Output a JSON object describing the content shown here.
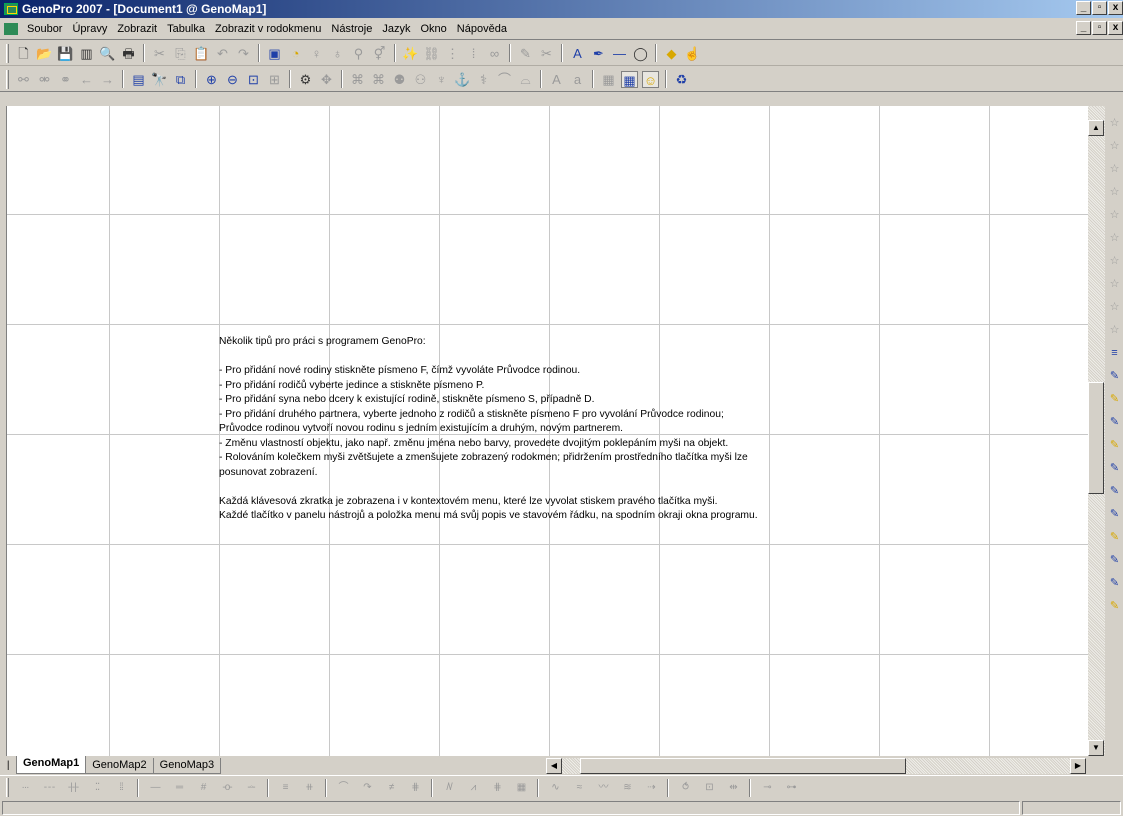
{
  "window": {
    "title": "GenoPro 2007 - [Document1 @ GenoMap1]",
    "controls": [
      "_",
      "▫",
      "x"
    ]
  },
  "menu": {
    "items": [
      "Soubor",
      "Úpravy",
      "Zobrazit",
      "Tabulka",
      "Zobrazit v rodokmenu",
      "Nástroje",
      "Jazyk",
      "Okno",
      "Nápověda"
    ]
  },
  "toolbar1": {
    "groups": [
      [
        {
          "icon": "new-document-icon",
          "glyph": "🗋",
          "color": "c-dark"
        },
        {
          "icon": "open-folder-icon",
          "glyph": "📂",
          "color": "c-yellow"
        },
        {
          "icon": "save-icon",
          "glyph": "💾",
          "color": "c-blue"
        },
        {
          "icon": "properties-icon",
          "glyph": "▥",
          "color": "c-dark"
        },
        {
          "icon": "print-preview-icon",
          "glyph": "🔍",
          "color": "c-dark"
        },
        {
          "icon": "print-icon",
          "glyph": "🖶",
          "color": "c-dark"
        }
      ],
      [
        {
          "icon": "cut-icon",
          "glyph": "✂",
          "color": "c-gray"
        },
        {
          "icon": "copy-icon",
          "glyph": "⎘",
          "color": "c-gray"
        },
        {
          "icon": "paste-icon",
          "glyph": "📋",
          "color": "c-gray"
        },
        {
          "icon": "undo-icon",
          "glyph": "↶",
          "color": "c-gray"
        },
        {
          "icon": "redo-icon",
          "glyph": "↷",
          "color": "c-gray"
        }
      ],
      [
        {
          "icon": "select-icon",
          "glyph": "▣",
          "color": "c-blue"
        },
        {
          "icon": "family-wizard-icon",
          "glyph": "◔",
          "color": "c-yellow"
        },
        {
          "icon": "add-family-icon",
          "glyph": "♀",
          "color": "c-gray"
        },
        {
          "icon": "add-parents-icon",
          "glyph": "♁",
          "color": "c-gray"
        },
        {
          "icon": "add-child-icon",
          "glyph": "⚲",
          "color": "c-gray"
        },
        {
          "icon": "add-partner-icon",
          "glyph": "⚥",
          "color": "c-gray"
        }
      ],
      [
        {
          "icon": "magic-wand-icon",
          "glyph": "✨",
          "color": "c-dark"
        },
        {
          "icon": "link-icon",
          "glyph": "⛓",
          "color": "c-gray"
        },
        {
          "icon": "pedigree-icon",
          "glyph": "⋮",
          "color": "c-gray"
        },
        {
          "icon": "descendants-icon",
          "glyph": "⁞",
          "color": "c-gray"
        },
        {
          "icon": "relationship-icon",
          "glyph": "∞",
          "color": "c-gray"
        }
      ],
      [
        {
          "icon": "pen-icon",
          "glyph": "✎",
          "color": "c-gray"
        },
        {
          "icon": "scissors-link-icon",
          "glyph": "✂",
          "color": "c-gray"
        }
      ],
      [
        {
          "icon": "text-label-icon",
          "glyph": "A",
          "color": "c-blue"
        },
        {
          "icon": "marker-icon",
          "glyph": "✒",
          "color": "c-blue"
        },
        {
          "icon": "line-icon",
          "glyph": "—",
          "color": "c-blue"
        },
        {
          "icon": "ellipse-icon",
          "glyph": "◯",
          "color": "c-dark"
        }
      ],
      [
        {
          "icon": "fill-color-icon",
          "glyph": "◆",
          "color": "c-yellow"
        },
        {
          "icon": "hand-icon",
          "glyph": "☝",
          "color": "c-gray"
        }
      ]
    ]
  },
  "toolbar2": {
    "groups": [
      [
        {
          "icon": "link-left-icon",
          "glyph": "⚯",
          "color": "c-gray"
        },
        {
          "icon": "unlink-icon",
          "glyph": "⚮",
          "color": "c-gray"
        },
        {
          "icon": "merge-icon",
          "glyph": "⚭",
          "color": "c-gray"
        },
        {
          "icon": "back-icon",
          "glyph": "←",
          "color": "c-gray"
        },
        {
          "icon": "forward-icon",
          "glyph": "→",
          "color": "c-gray"
        }
      ],
      [
        {
          "icon": "table-icon",
          "glyph": "▤",
          "color": "c-blue"
        },
        {
          "icon": "find-icon",
          "glyph": "🔭",
          "color": "c-dark"
        },
        {
          "icon": "find-replace-icon",
          "glyph": "⧉",
          "color": "c-blue"
        }
      ],
      [
        {
          "icon": "zoom-in-icon",
          "glyph": "⊕",
          "color": "c-blue"
        },
        {
          "icon": "zoom-out-icon",
          "glyph": "⊖",
          "color": "c-blue"
        },
        {
          "icon": "zoom-fit-icon",
          "glyph": "⊡",
          "color": "c-blue"
        },
        {
          "icon": "zoom-selection-icon",
          "glyph": "⊞",
          "color": "c-gray"
        }
      ],
      [
        {
          "icon": "rotate-icon",
          "glyph": "⚙",
          "color": "c-dark"
        },
        {
          "icon": "move-icon",
          "glyph": "✥",
          "color": "c-gray"
        }
      ],
      [
        {
          "icon": "layout-tree-1-icon",
          "glyph": "⌘",
          "color": "c-gray"
        },
        {
          "icon": "layout-tree-2-icon",
          "glyph": "⌘",
          "color": "c-gray"
        },
        {
          "icon": "layout-tree-3-icon",
          "glyph": "⚉",
          "color": "c-gray"
        },
        {
          "icon": "layout-tree-4-icon",
          "glyph": "⚇",
          "color": "c-gray"
        },
        {
          "icon": "layout-tree-5-icon",
          "glyph": "♆",
          "color": "c-gray"
        },
        {
          "icon": "layout-tree-6-icon",
          "glyph": "⚓",
          "color": "c-gray"
        },
        {
          "icon": "layout-tree-7-icon",
          "glyph": "⚕",
          "color": "c-gray"
        },
        {
          "icon": "layout-tree-8-icon",
          "glyph": "⌒",
          "color": "c-gray"
        },
        {
          "icon": "layout-tree-9-icon",
          "glyph": "⌓",
          "color": "c-gray"
        }
      ],
      [
        {
          "icon": "font-larger-icon",
          "glyph": "A",
          "color": "c-gray"
        },
        {
          "icon": "font-smaller-icon",
          "glyph": "a",
          "color": "c-gray"
        }
      ],
      [
        {
          "icon": "grid-hidden-icon",
          "glyph": "▦",
          "color": "c-gray"
        },
        {
          "icon": "grid-show-icon",
          "glyph": "▦",
          "color": "c-blue",
          "active": true
        },
        {
          "icon": "emoticon-icon",
          "glyph": "☺",
          "color": "c-yellow",
          "active": true
        }
      ],
      [
        {
          "icon": "refresh-icon",
          "glyph": "♻",
          "color": "c-blue"
        }
      ]
    ]
  },
  "canvas": {
    "tips": [
      "Několik tipů pro práci s programem GenoPro:",
      "",
      "- Pro přidání nové rodiny stiskněte písmeno F, čímž vyvoláte Průvodce rodinou.",
      "- Pro přidání rodičů vyberte jedince a stiskněte písmeno P.",
      "- Pro přidání syna nebo dcery k existující rodině, stiskněte písmeno S, případně D.",
      "- Pro přidání druhého partnera, vyberte jednoho z rodičů a stiskněte písmeno F pro vyvolání Průvodce rodinou;",
      "  Průvodce rodinou vytvoří novou rodinu s jedním existujícím a druhým, novým partnerem.",
      "- Změnu vlastností objektu, jako např. změnu jména nebo barvy, provedete dvojitým poklepáním myši na objekt.",
      "- Rolováním kolečkem myši zvětšujete a zmenšujete zobrazený rodokmen; přidržením prostředního tlačítka myši  lze",
      "posunovat zobrazení.",
      "",
      "Každá klávesová zkratka je zobrazena i v kontextovém menu, které lze vyvolat stiskem pravého tlačítka myši.",
      "Každé tlačítko v panelu nástrojů a položka menu má svůj popis ve stavovém řádku, na spodním okraji okna programu."
    ]
  },
  "tabs": {
    "items": [
      "GenoMap1",
      "GenoMap2",
      "GenoMap3"
    ],
    "active": 0
  },
  "side_palette": {
    "icons": [
      {
        "icon": "palette-star-1-icon",
        "glyph": "☆",
        "color": "c-gray"
      },
      {
        "icon": "palette-star-2-icon",
        "glyph": "☆",
        "color": "c-gray"
      },
      {
        "icon": "palette-star-3-icon",
        "glyph": "☆",
        "color": "c-gray"
      },
      {
        "icon": "palette-star-4-icon",
        "glyph": "☆",
        "color": "c-gray"
      },
      {
        "icon": "palette-star-5-icon",
        "glyph": "☆",
        "color": "c-gray"
      },
      {
        "icon": "palette-star-6-icon",
        "glyph": "☆",
        "color": "c-gray"
      },
      {
        "icon": "palette-star-7-icon",
        "glyph": "☆",
        "color": "c-gray"
      },
      {
        "icon": "palette-star-8-icon",
        "glyph": "☆",
        "color": "c-gray"
      },
      {
        "icon": "palette-star-9-icon",
        "glyph": "☆",
        "color": "c-gray"
      },
      {
        "icon": "palette-star-10-icon",
        "glyph": "☆",
        "color": "c-gray"
      },
      {
        "icon": "palette-list-icon",
        "glyph": "≡",
        "color": "c-blue"
      },
      {
        "icon": "palette-wand-1-icon",
        "glyph": "✎",
        "color": "c-blue"
      },
      {
        "icon": "palette-wand-2-icon",
        "glyph": "✎",
        "color": "c-yellow"
      },
      {
        "icon": "palette-wand-3-icon",
        "glyph": "✎",
        "color": "c-blue"
      },
      {
        "icon": "palette-wand-4-icon",
        "glyph": "✎",
        "color": "c-yellow"
      },
      {
        "icon": "palette-wand-5-icon",
        "glyph": "✎",
        "color": "c-blue"
      },
      {
        "icon": "palette-wand-6-icon",
        "glyph": "✎",
        "color": "c-blue"
      },
      {
        "icon": "palette-wand-7-icon",
        "glyph": "✎",
        "color": "c-blue"
      },
      {
        "icon": "palette-wand-8-icon",
        "glyph": "✎",
        "color": "c-yellow"
      },
      {
        "icon": "palette-wand-9-icon",
        "glyph": "✎",
        "color": "c-blue"
      },
      {
        "icon": "palette-wand-10-icon",
        "glyph": "✎",
        "color": "c-blue"
      },
      {
        "icon": "palette-highlight-icon",
        "glyph": "✎",
        "color": "c-yellow"
      }
    ]
  },
  "bottom_toolbar": {
    "items": [
      {
        "icon": "line-dotted-icon",
        "glyph": "···"
      },
      {
        "icon": "line-dashed-icon",
        "glyph": "- - -"
      },
      {
        "icon": "line-ticked-icon",
        "glyph": "-|-|-"
      },
      {
        "icon": "line-double-dotted-icon",
        "glyph": "⁚⁚"
      },
      {
        "icon": "line-double-dash-icon",
        "glyph": "⁞⁞"
      },
      {
        "icon": "line-solid-icon",
        "glyph": "—"
      },
      {
        "icon": "line-double-icon",
        "glyph": "═"
      },
      {
        "icon": "line-hash-icon",
        "glyph": "#"
      },
      {
        "icon": "line-circle-icon",
        "glyph": "-o-"
      },
      {
        "icon": "line-circle-double-icon",
        "glyph": "-◦-"
      },
      {
        "icon": "line-triple-icon",
        "glyph": "≡"
      },
      {
        "icon": "line-triple-hash-icon",
        "glyph": "⧺"
      },
      {
        "icon": "line-arc-icon",
        "glyph": "⌒"
      },
      {
        "icon": "line-arc-arrow-icon",
        "glyph": "↷"
      },
      {
        "icon": "line-equal-hash-icon",
        "glyph": "≠"
      },
      {
        "icon": "line-box-hash-icon",
        "glyph": "⋕"
      },
      {
        "icon": "line-zigzag-icon",
        "glyph": "/\\/"
      },
      {
        "icon": "line-zigzag-hash-icon",
        "glyph": "⩘"
      },
      {
        "icon": "line-cross-hash-icon",
        "glyph": "⋕"
      },
      {
        "icon": "line-grid-icon",
        "glyph": "▦"
      },
      {
        "icon": "line-wave-icon",
        "glyph": "∿"
      },
      {
        "icon": "line-wave-double-icon",
        "glyph": "≈"
      },
      {
        "icon": "line-wave-small-icon",
        "glyph": "〰"
      },
      {
        "icon": "line-wave-equal-icon",
        "glyph": "≋"
      },
      {
        "icon": "line-arrow-icon",
        "glyph": "⇢"
      },
      {
        "icon": "line-loop-icon",
        "glyph": "⥀"
      },
      {
        "icon": "line-loop-box-icon",
        "glyph": "⊡"
      },
      {
        "icon": "line-loop-arrow-icon",
        "glyph": "⇹"
      },
      {
        "icon": "line-ring-icon",
        "glyph": "⊸"
      },
      {
        "icon": "line-ring-double-icon",
        "glyph": "⊶"
      }
    ]
  }
}
